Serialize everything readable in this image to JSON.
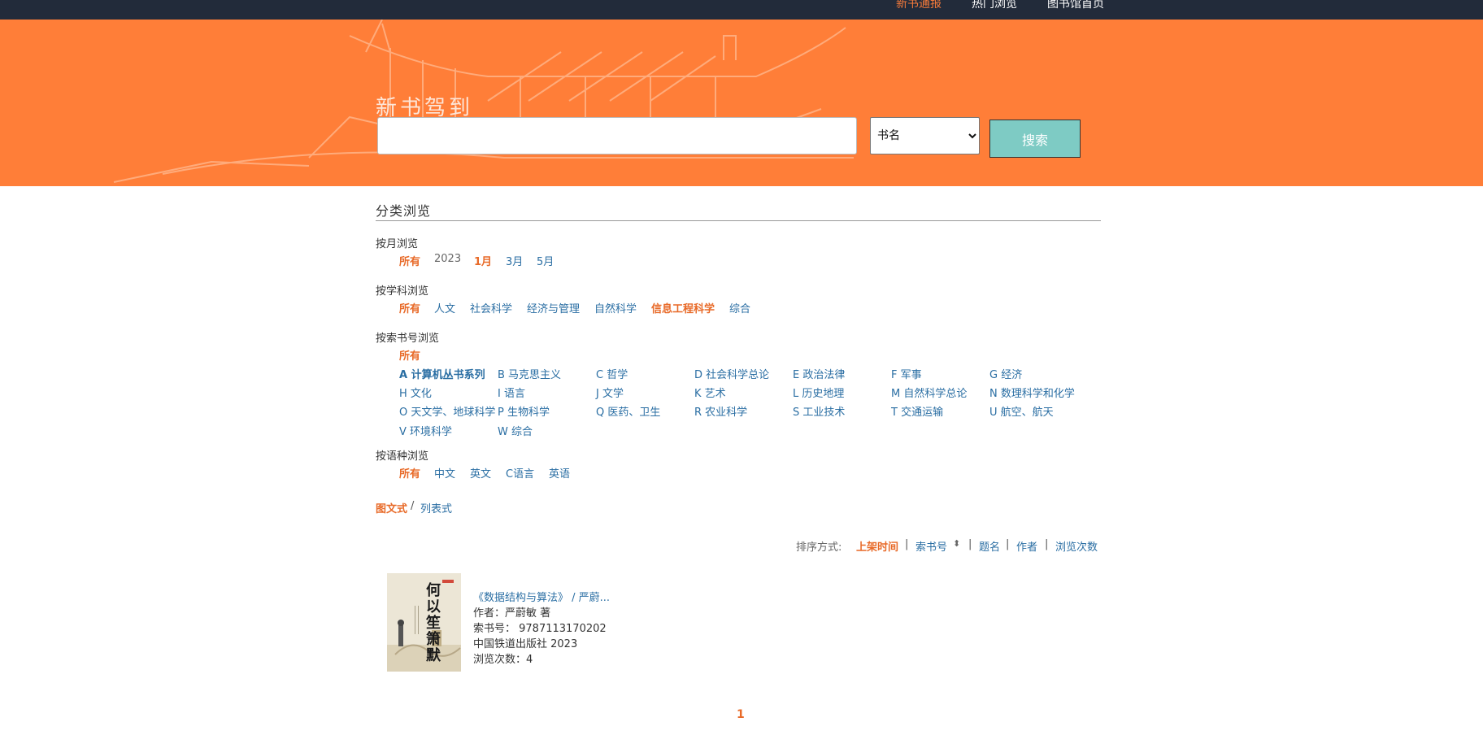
{
  "topnav": {
    "items": [
      "新书通报",
      "热门浏览",
      "图书馆首页"
    ]
  },
  "banner": {
    "title": "新书驾到"
  },
  "search": {
    "value": "",
    "placeholder": "",
    "select_value": "书名",
    "button_label": "搜索"
  },
  "categories": {
    "title": "分类浏览",
    "by_month": {
      "label": "按月浏览",
      "items": [
        "所有",
        "2023",
        "1月",
        "3月",
        "5月"
      ]
    },
    "by_subject": {
      "label": "按学科浏览",
      "items": [
        "所有",
        "人文",
        "社会科学",
        "经济与管理",
        "自然科学",
        "信息工程科学",
        "综合"
      ]
    },
    "by_callno": {
      "label": "按索书号浏览",
      "all": "所有",
      "items": [
        "A 计算机丛书系列",
        "B 马克思主义",
        "C 哲学",
        "D 社会科学总论",
        "E 政治法律",
        "F 军事",
        "G 经济",
        "H 文化",
        "I 语言",
        "J 文学",
        "K 艺术",
        "L 历史地理",
        "M 自然科学总论",
        "N 数理科学和化学",
        "O 天文学、地球科学",
        "P 生物科学",
        "Q 医药、卫生",
        "R 农业科学",
        "S 工业技术",
        "T 交通运输",
        "U 航空、航天",
        "V 环境科学",
        "W 综合"
      ]
    },
    "by_language": {
      "label": "按语种浏览",
      "items": [
        "所有",
        "中文",
        "英文",
        "C语言",
        "英语"
      ]
    }
  },
  "view": {
    "grid": "图文式",
    "sep": "/",
    "list": "列表式"
  },
  "sort": {
    "label": "排序方式:",
    "items": [
      "上架时间",
      "索书号",
      "题名",
      "作者",
      "浏览次数"
    ],
    "divider": "|",
    "arrows": "⬍"
  },
  "book": {
    "title": "《数据结构与算法》 / 严蔚...",
    "author": "作者：严蔚敏 著",
    "callno": "索书号： 9787113170202",
    "publisher": "中国铁道出版社 2023",
    "views": "浏览次数：4",
    "cover_text": "何以笙箫默"
  },
  "pagination": {
    "current": "1"
  },
  "colors": {
    "accent": "#ff7e38",
    "topbar": "#222b3a",
    "link": "#2a6ea3",
    "selected": "#e86a28",
    "button": "#7ecbc4"
  }
}
